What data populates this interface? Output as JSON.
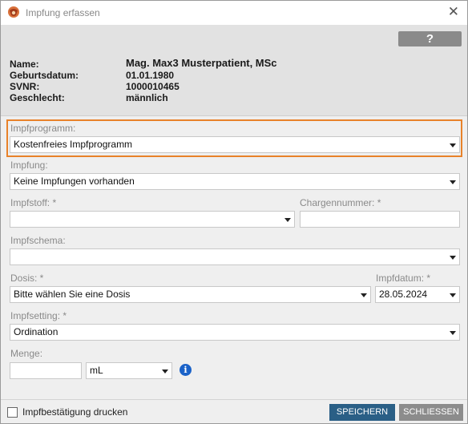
{
  "window": {
    "title": "Impfung erfassen"
  },
  "header": {
    "help_label": "?",
    "patient": {
      "name_label": "Name:",
      "name": "Mag. Max3 Musterpatient, MSc",
      "dob_label": "Geburtsdatum:",
      "dob": "01.01.1980",
      "svnr_label": "SVNR:",
      "svnr": "1000010465",
      "gender_label": "Geschlecht:",
      "gender": "männlich"
    }
  },
  "form": {
    "impfprogramm": {
      "label": "Impfprogramm:",
      "value": "Kostenfreies Impfprogramm"
    },
    "impfung": {
      "label": "Impfung:",
      "value": "Keine Impfungen vorhanden"
    },
    "impfstoff": {
      "label": "Impfstoff: *",
      "value": ""
    },
    "chargennummer": {
      "label": "Chargennummer: *",
      "value": ""
    },
    "impfschema": {
      "label": "Impfschema:",
      "value": ""
    },
    "dosis": {
      "label": "Dosis: *",
      "value": "Bitte wählen Sie eine Dosis"
    },
    "impfdatum": {
      "label": "Impfdatum: *",
      "value": "28.05.2024"
    },
    "impfsetting": {
      "label": "Impfsetting: *",
      "value": "Ordination"
    },
    "menge": {
      "label": "Menge:",
      "value": "",
      "unit": "mL"
    }
  },
  "footer": {
    "print_label": "Impfbestätigung drucken",
    "save_label": "SPEICHERN",
    "close_label": "SCHLIESSEN"
  },
  "colors": {
    "highlight": "#e8822a",
    "save_button": "#2a5f86",
    "info_icon": "#1a62c8"
  }
}
